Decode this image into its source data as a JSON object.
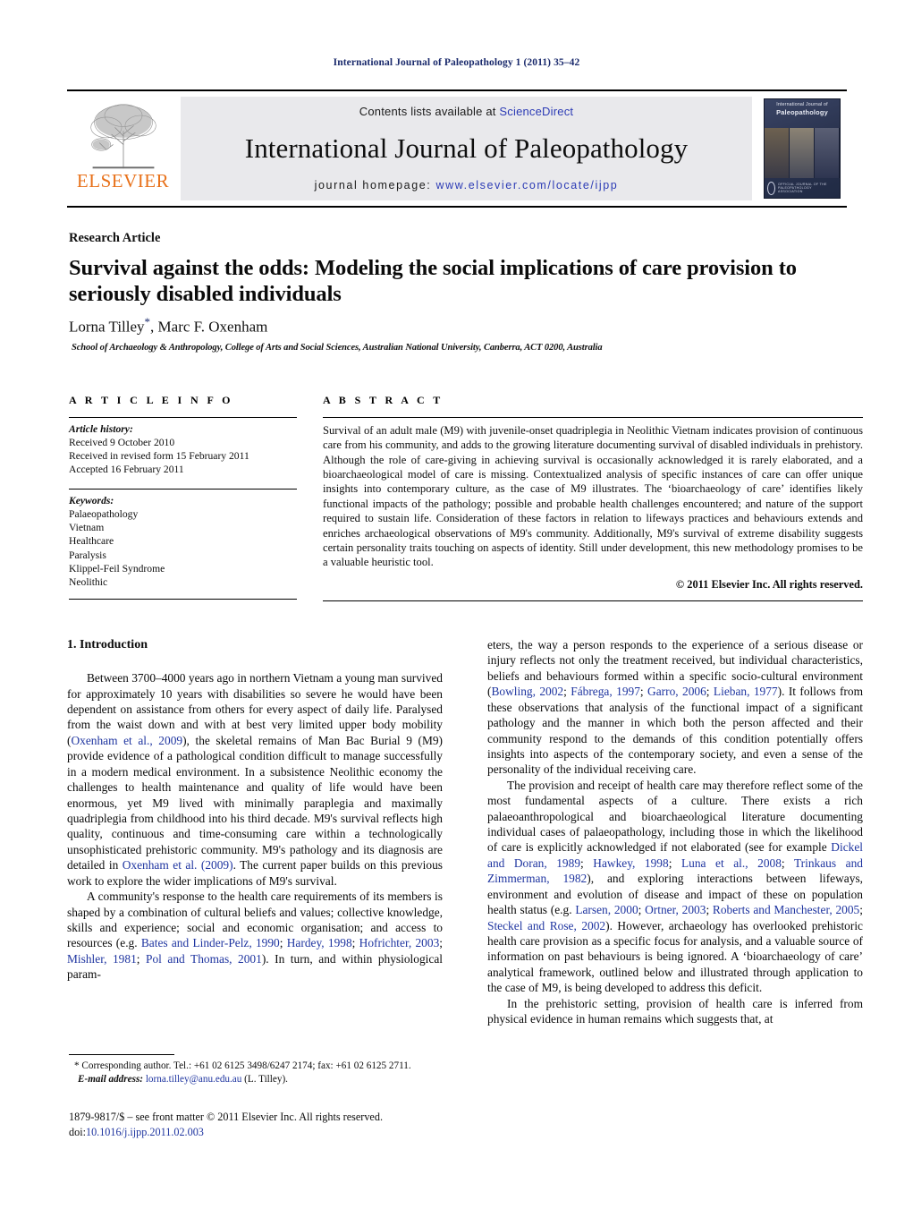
{
  "running_head": "International Journal of Paleopathology 1 (2011) 35–42",
  "masthead": {
    "publisher_logo_text": "ELSEVIER",
    "publisher_logo_icon": "elsevier-tree-icon",
    "contents_prefix": "Contents lists available at",
    "contents_link": "ScienceDirect",
    "journal_title": "International Journal of Paleopathology",
    "homepage_prefix": "journal homepage:",
    "homepage_url": "www.elsevier.com/locate/ijpp",
    "cover": {
      "line1": "International Journal of",
      "line2": "Paleopathology",
      "footer_text": "OFFICIAL JOURNAL OF THE PALEOPATHOLOGY ASSOCIATION"
    }
  },
  "article": {
    "type": "Research Article",
    "title": "Survival against the odds: Modeling the social implications of care provision to seriously disabled individuals",
    "authors": "Lorna Tilley",
    "authors_rest": ", Marc F. Oxenham",
    "corresponding_marker": "*",
    "affiliation": "School of Archaeology & Anthropology, College of Arts and Social Sciences, Australian National University, Canberra, ACT 0200, Australia"
  },
  "info": {
    "heading": "A R T I C L E   I N F O",
    "history_label": "Article history:",
    "history": [
      "Received 9 October 2010",
      "Received in revised form 15 February 2011",
      "Accepted 16 February 2011"
    ],
    "keywords_label": "Keywords:",
    "keywords": [
      "Palaeopathology",
      "Vietnam",
      "Healthcare",
      "Paralysis",
      "Klippel-Feil Syndrome",
      "Neolithic"
    ]
  },
  "abstract": {
    "heading": "A B S T R A C T",
    "text": "Survival of an adult male (M9) with juvenile-onset quadriplegia in Neolithic Vietnam indicates provision of continuous care from his community, and adds to the growing literature documenting survival of disabled individuals in prehistory. Although the role of care-giving in achieving survival is occasionally acknowledged it is rarely elaborated, and a bioarchaeological model of care is missing. Contextualized analysis of specific instances of care can offer unique insights into contemporary culture, as the case of M9 illustrates. The ‘bioarchaeology of care’ identifies likely functional impacts of the pathology; possible and probable health challenges encountered; and nature of the support required to sustain life. Consideration of these factors in relation to lifeways practices and behaviours extends and enriches archaeological observations of M9's community. Additionally, M9's survival of extreme disability suggests certain personality traits touching on aspects of identity. Still under development, this new methodology promises to be a valuable heuristic tool.",
    "copyright": "© 2011 Elsevier Inc. All rights reserved."
  },
  "body": {
    "section_number_title": "1. Introduction",
    "left_paragraphs": [
      "Between 3700–4000 years ago in northern Vietnam a young man survived for approximately 10 years with disabilities so severe he would have been dependent on assistance from others for every aspect of daily life. Paralysed from the waist down and with at best very limited upper body mobility (Oxenham et al., 2009), the skeletal remains of Man Bac Burial 9 (M9) provide evidence of a pathological condition difficult to manage successfully in a modern medical environment. In a subsistence Neolithic economy the challenges to health maintenance and quality of life would have been enormous, yet M9 lived with minimally paraplegia and maximally quadriplegia from childhood into his third decade. M9's survival reflects high quality, continuous and time-consuming care within a technologically unsophisticated prehistoric community. M9's pathology and its diagnosis are detailed in Oxenham et al. (2009). The current paper builds on this previous work to explore the wider implications of M9's survival.",
      "A community's response to the health care requirements of its members is shaped by a combination of cultural beliefs and values; collective knowledge, skills and experience; social and economic organisation; and access to resources (e.g. Bates and Linder-Pelz, 1990; Hardey, 1998; Hofrichter, 2003; Mishler, 1981; Pol and Thomas, 2001). In turn, and within physiological param-"
    ],
    "right_paragraphs": [
      "eters, the way a person responds to the experience of a serious disease or injury reflects not only the treatment received, but individual characteristics, beliefs and behaviours formed within a specific socio-cultural environment (Bowling, 2002; Fábrega, 1997; Garro, 2006; Lieban, 1977). It follows from these observations that analysis of the functional impact of a significant pathology and the manner in which both the person affected and their community respond to the demands of this condition potentially offers insights into aspects of the contemporary society, and even a sense of the personality of the individual receiving care.",
      "The provision and receipt of health care may therefore reflect some of the most fundamental aspects of a culture. There exists a rich palaeoanthropological and bioarchaeological literature documenting individual cases of palaeopathology, including those in which the likelihood of care is explicitly acknowledged if not elaborated (see for example Dickel and Doran, 1989; Hawkey, 1998; Luna et al., 2008; Trinkaus and Zimmerman, 1982), and exploring interactions between lifeways, environment and evolution of disease and impact of these on population health status (e.g. Larsen, 2000; Ortner, 2003; Roberts and Manchester, 2005; Steckel and Rose, 2002). However, archaeology has overlooked prehistoric health care provision as a specific focus for analysis, and a valuable source of information on past behaviours is being ignored. A ‘bioarchaeology of care’ analytical framework, outlined below and illustrated through application to the case of M9, is being developed to address this deficit.",
      "In the prehistoric setting, provision of health care is inferred from physical evidence in human remains which suggests that, at"
    ],
    "citations_left": [
      "Oxenham et al., 2009",
      "Oxenham et al. (2009)",
      "Bates and Linder-Pelz, 1990",
      "Hardey, 1998",
      "Hofrichter, 2003",
      "Mishler, 1981",
      "Pol and Thomas, 2001"
    ],
    "citations_right": [
      "Bowling, 2002",
      "Fábrega, 1997",
      "Garro, 2006",
      "Lieban, 1977",
      "Dickel and Doran, 1989",
      "Hawkey, 1998",
      "Luna et al., 2008",
      "Trinkaus and Zimmerman, 1982",
      "Larsen, 2000",
      "Ortner, 2003",
      "Roberts and Manchester, 2005",
      "Steckel and Rose, 2002"
    ]
  },
  "footnote": {
    "marker": "*",
    "line1": "Corresponding author. Tel.: +61 02 6125 3498/6247 2174; fax: +61 02 6125 2711.",
    "email_label": "E-mail address:",
    "email": "lorna.tilley@anu.edu.au",
    "email_owner": "(L. Tilley)."
  },
  "footer": {
    "issn_line": "1879-9817/$ – see front matter © 2011 Elsevier Inc. All rights reserved.",
    "doi_prefix": "doi:",
    "doi": "10.1016/j.ijpp.2011.02.003"
  },
  "colors": {
    "link_blue": "#1f35a0",
    "header_navy": "#1a2a6c",
    "elsevier_orange": "#e8711a",
    "band_gray": "#e9e9ec"
  }
}
